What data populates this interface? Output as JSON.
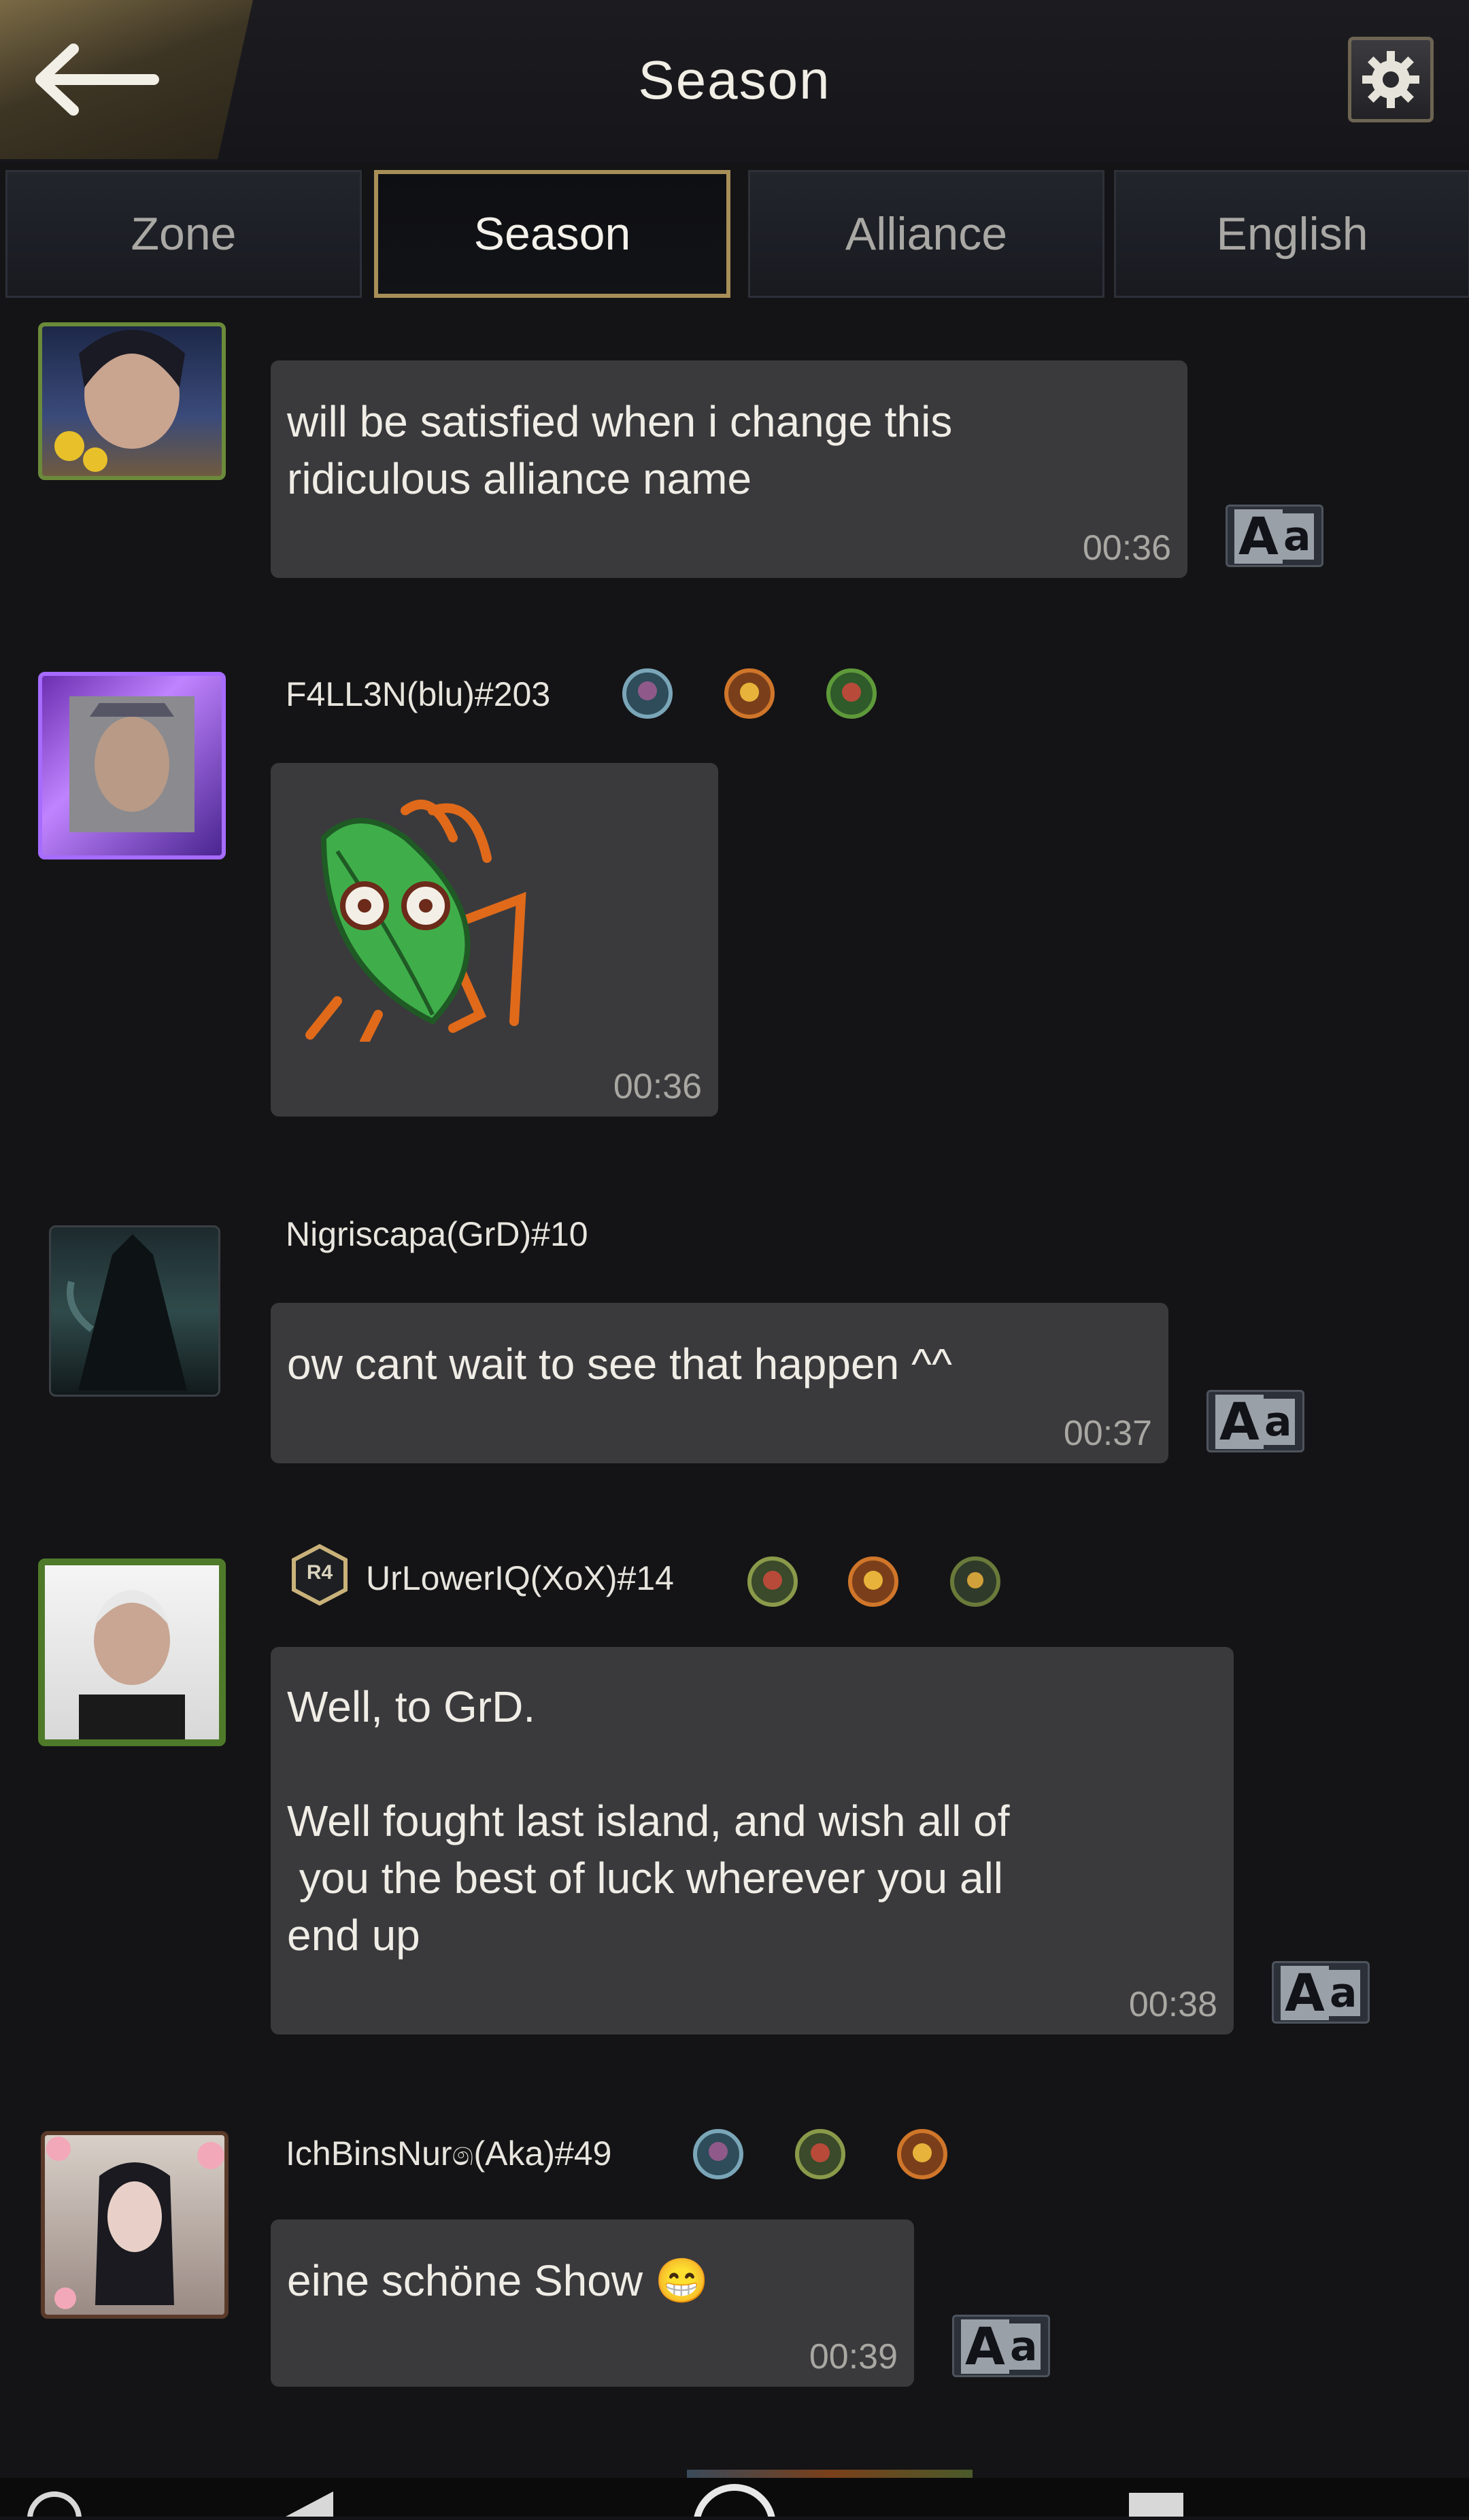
{
  "header": {
    "back_label": "",
    "title": "Season"
  },
  "tabs": [
    {
      "label": "Zone",
      "active": false
    },
    {
      "label": "Season",
      "active": true
    },
    {
      "label": "Alliance",
      "active": false
    },
    {
      "label": "English",
      "active": false
    }
  ],
  "messages": [
    {
      "name": "",
      "text": "will be satisfied when i change this\nridiculous alliance name",
      "time": "00:36",
      "translate": "Aa"
    },
    {
      "name": "F4LL3N(blu)#203",
      "sticker": "leaf-bug-sticker",
      "time": "00:36"
    },
    {
      "name": "Nigriscapa(GrD)#10",
      "text": "ow cant wait to see that happen ^^",
      "time": "00:37",
      "translate": "Aa"
    },
    {
      "rank": "R4",
      "name": "UrLowerIQ(XoX)#14",
      "text": "Well, to GrD.\n\nWell fought last island, and wish all of\n you the best of luck wherever you all\nend up",
      "time": "00:38",
      "translate": "Aa"
    },
    {
      "name": "IchBinsNur෧(Aka)#49",
      "text": "eine schöne Show 😁",
      "time": "00:39",
      "translate": "Aa"
    }
  ],
  "colors": {
    "accent_gold": "#a88f58",
    "bubble": "#3a3a3d",
    "background": "#141416"
  }
}
